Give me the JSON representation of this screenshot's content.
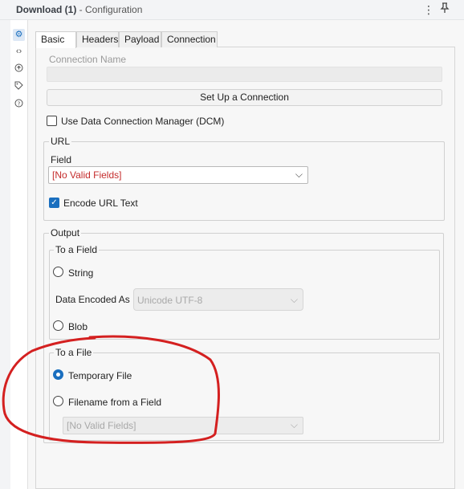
{
  "window": {
    "title_strong": "Download (1)",
    "title_sub": " - Configuration",
    "menu_icon": "kebab-menu-icon",
    "pin_icon": "pin-icon"
  },
  "nav": [
    "gear-icon",
    "code-icon",
    "annotation-icon",
    "tag-icon",
    "help-icon"
  ],
  "tabs": [
    "Basic",
    "Headers",
    "Payload",
    "Connection"
  ],
  "connection": {
    "label": "Connection Name",
    "value": "",
    "setup_button": "Set Up a Connection"
  },
  "dcm": {
    "label": "Use Data Connection Manager (DCM)",
    "checked": false
  },
  "url": {
    "legend": "URL",
    "field_label": "Field",
    "field_value": "[No Valid Fields]",
    "encode_label": "Encode URL Text",
    "encode_checked": true
  },
  "output": {
    "legend": "Output",
    "to_field": {
      "legend": "To a Field",
      "string_label": "String",
      "encoded_as_label": "Data Encoded As",
      "encoded_as_value": "Unicode UTF-8",
      "blob_label": "Blob"
    },
    "to_file": {
      "legend": "To a File",
      "temp_label": "Temporary File",
      "filename_label": "Filename from a Field",
      "filename_value": "[No Valid Fields]",
      "selected": "Temporary File"
    }
  },
  "colors": {
    "accent": "#1a6fbf",
    "error_text": "#c42b2b",
    "annotation": "#d42020"
  }
}
